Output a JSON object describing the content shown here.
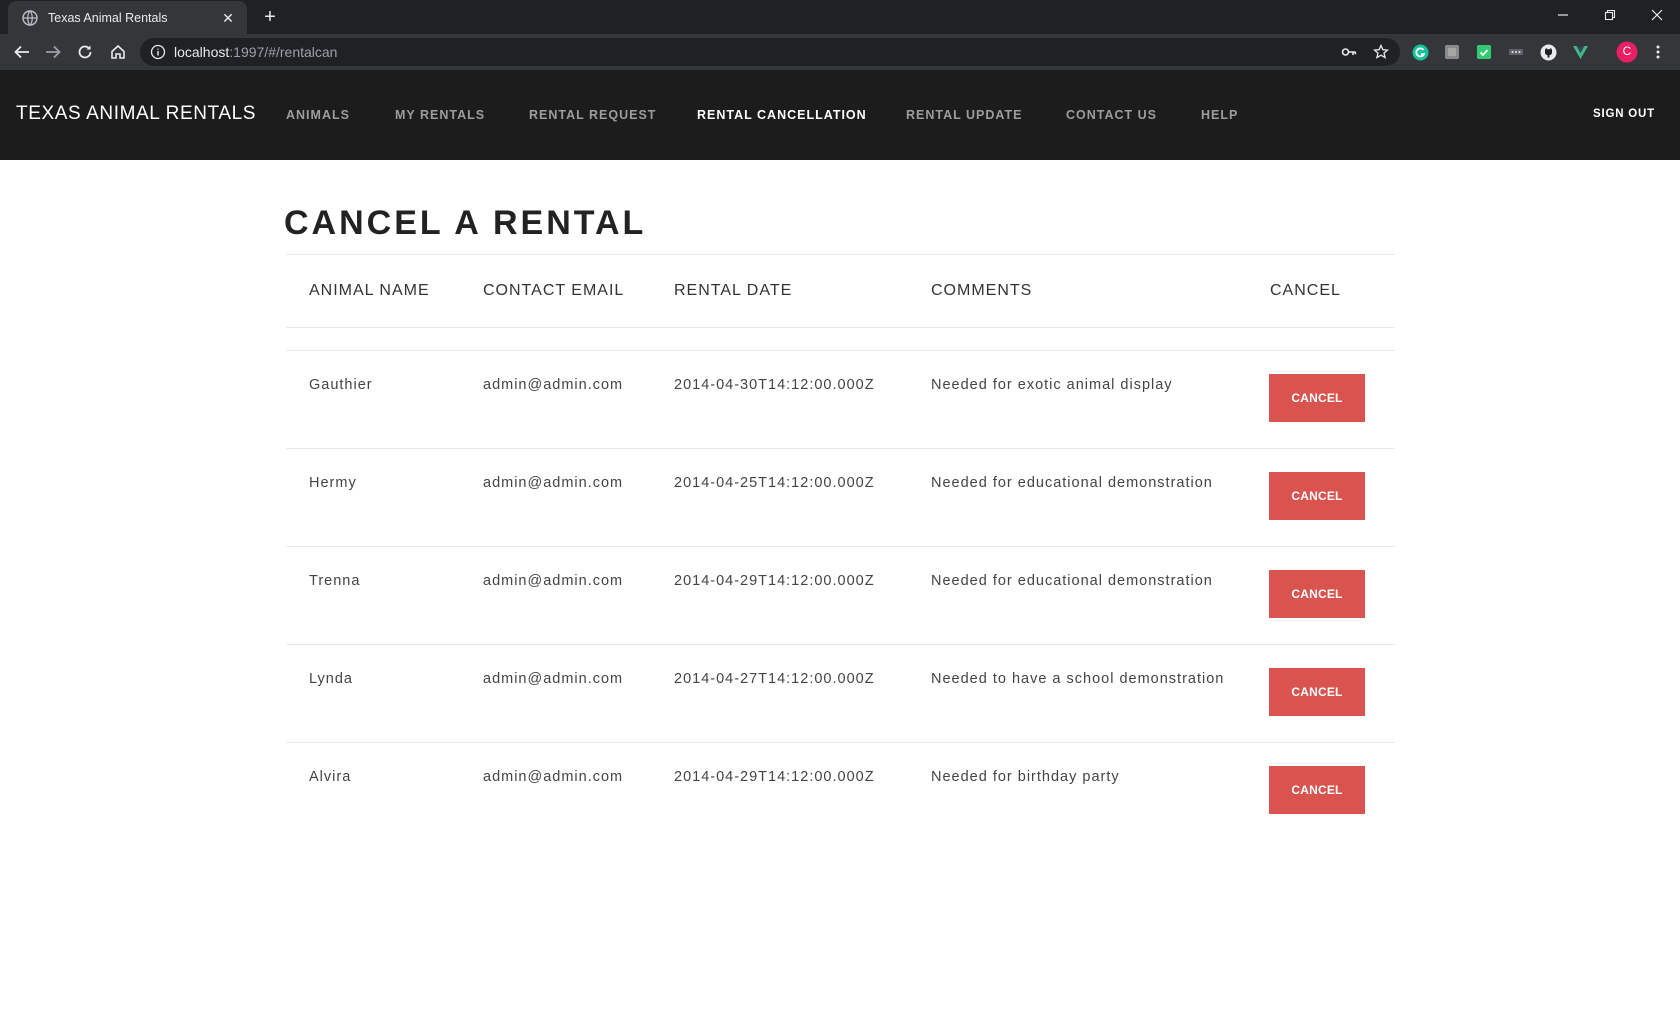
{
  "browser": {
    "tab_title": "Texas Animal Rentals",
    "close_glyph": "✕",
    "new_tab_glyph": "+",
    "url_host": "localhost",
    "url_path": ":1997/#/rentalcan"
  },
  "navbar": {
    "brand": "TEXAS ANIMAL RENTALS",
    "links": [
      {
        "label": "ANIMALS",
        "active": false
      },
      {
        "label": "MY RENTALS",
        "active": false
      },
      {
        "label": "RENTAL REQUEST",
        "active": false
      },
      {
        "label": "RENTAL CANCELLATION",
        "active": true
      },
      {
        "label": "RENTAL UPDATE",
        "active": false
      },
      {
        "label": "CONTACT US",
        "active": false
      },
      {
        "label": "HELP",
        "active": false
      }
    ],
    "sign_out": "SIGN OUT"
  },
  "page": {
    "title": "CANCEL A RENTAL"
  },
  "table": {
    "headers": [
      "ANIMAL NAME",
      "CONTACT EMAIL",
      "RENTAL DATE",
      "COMMENTS",
      "CANCEL"
    ],
    "rows": [
      {
        "animal": "Gauthier",
        "email": "admin@admin.com",
        "date": "2014-04-30T14:12:00.000Z",
        "comments": "Needed for exotic animal display",
        "button": "CANCEL"
      },
      {
        "animal": "Hermy",
        "email": "admin@admin.com",
        "date": "2014-04-25T14:12:00.000Z",
        "comments": "Needed for educational demonstration",
        "button": "CANCEL"
      },
      {
        "animal": "Trenna",
        "email": "admin@admin.com",
        "date": "2014-04-29T14:12:00.000Z",
        "comments": "Needed for educational demonstration",
        "button": "CANCEL"
      },
      {
        "animal": "Lynda",
        "email": "admin@admin.com",
        "date": "2014-04-27T14:12:00.000Z",
        "comments": "Needed to have a school demonstration",
        "button": "CANCEL"
      },
      {
        "animal": "Alvira",
        "email": "admin@admin.com",
        "date": "2014-04-29T14:12:00.000Z",
        "comments": "Needed for birthday party",
        "button": "CANCEL"
      }
    ]
  },
  "colors": {
    "navbar_bg": "#1c1c1c",
    "cancel_button": "#d9534f",
    "active_nav": "#ffffff",
    "inactive_nav": "#9d9d9d"
  },
  "icons": {
    "tab_favicon": "globe-icon",
    "back": "back-arrow-icon",
    "forward": "forward-arrow-icon",
    "reload": "reload-icon",
    "home": "home-icon",
    "site_info": "info-icon",
    "key": "key-icon",
    "bookmark": "star-icon",
    "profile_initial": "C"
  }
}
